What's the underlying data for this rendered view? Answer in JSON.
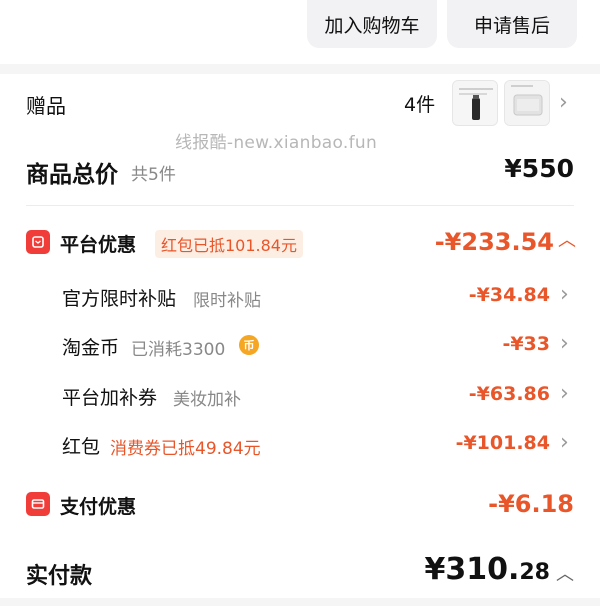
{
  "top_buttons": {
    "add_to_cart": "加入购物车",
    "apply_after_sale": "申请售后"
  },
  "gift": {
    "label": "赠品",
    "count": "4件"
  },
  "watermark": "线报酷-new.xianbao.fun",
  "goods_total": {
    "label": "商品总价",
    "sub": "共5件",
    "amount": "¥550"
  },
  "platform_discount": {
    "title": "平台优惠",
    "tag": "红包已抵101.84元",
    "amount": "-¥233.54",
    "items": [
      {
        "label": "官方限时补贴",
        "note": "限时补贴",
        "amount": "-¥34.84"
      },
      {
        "label": "淘金币",
        "note": "已消耗3300",
        "amount": "-¥33"
      },
      {
        "label": "平台加补券",
        "note": "美妆加补",
        "amount": "-¥63.86"
      },
      {
        "label": "红包",
        "note": "消费券已抵49.84元",
        "amount": "-¥101.84"
      }
    ]
  },
  "payment_discount": {
    "title": "支付优惠",
    "amount": "-¥6.18"
  },
  "paid": {
    "label": "实付款",
    "amount_int": "¥310.",
    "amount_dec": "28"
  },
  "colors": {
    "accent_orange": "#e8562a",
    "icon_red": "#f03d3a",
    "coin_gold": "#f5a623"
  }
}
